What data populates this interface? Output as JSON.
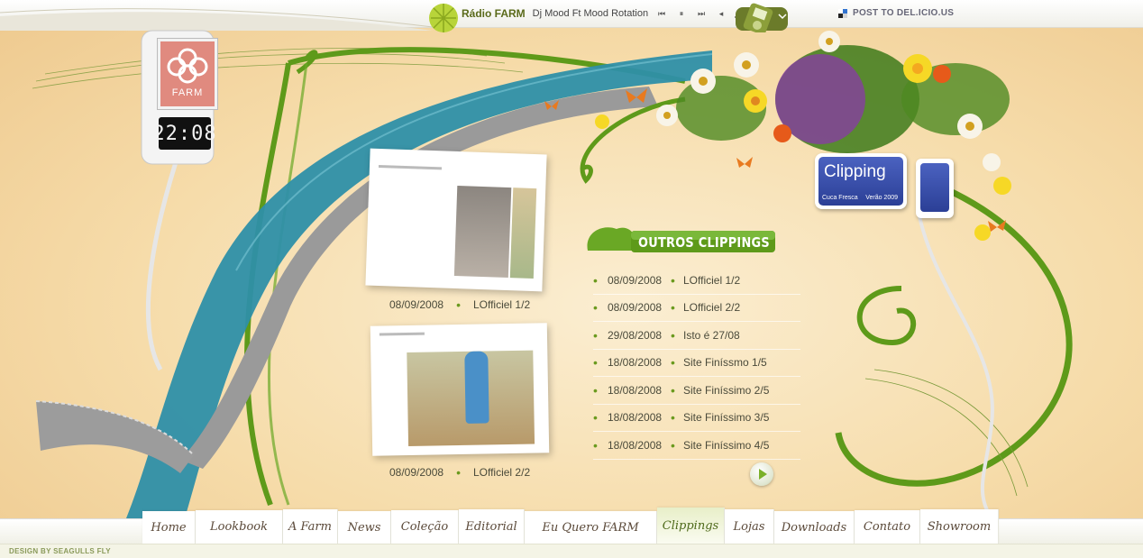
{
  "radio": {
    "label": "Rádio FARM",
    "song": "Dj Mood Ft Mood Rotation",
    "prev_icon": "skip-back-icon",
    "pause_icon": "pause-icon",
    "next_icon": "skip-forward-icon",
    "volume_icon": "volume-icon"
  },
  "post_to_delicious": "POST TO DEL.ICIO.US",
  "clock": {
    "time": "22:08",
    "brand": "FARM"
  },
  "sign": {
    "title": "Clipping",
    "left_sub": "Cuca Fresca",
    "right_sub": "Verão 2009"
  },
  "featured": [
    {
      "date": "08/09/2008",
      "title": "LOfficiel 1/2"
    },
    {
      "date": "08/09/2008",
      "title": "LOfficiel 2/2"
    }
  ],
  "outros": {
    "title": "OUTROS CLIPPINGS",
    "items": [
      {
        "date": "08/09/2008",
        "title": "LOfficiel 1/2"
      },
      {
        "date": "08/09/2008",
        "title": "LOfficiel 2/2"
      },
      {
        "date": "29/08/2008",
        "title": "Isto é  27/08"
      },
      {
        "date": "18/08/2008",
        "title": "Site Finíssmo 1/5"
      },
      {
        "date": "18/08/2008",
        "title": "Site Finíssimo 2/5"
      },
      {
        "date": "18/08/2008",
        "title": "Site Finíssimo 3/5"
      },
      {
        "date": "18/08/2008",
        "title": "Site Finíssimo 4/5"
      }
    ]
  },
  "nav": [
    {
      "label": "Home",
      "active": false
    },
    {
      "label": "Lookbook",
      "active": false
    },
    {
      "label": "A Farm",
      "active": false
    },
    {
      "label": "News",
      "active": false
    },
    {
      "label": "Coleção",
      "active": false
    },
    {
      "label": "Editorial",
      "active": false
    },
    {
      "label": "Eu Quero FARM",
      "active": false
    },
    {
      "label": "Clippings",
      "active": true
    },
    {
      "label": "Lojas",
      "active": false
    },
    {
      "label": "Downloads",
      "active": false
    },
    {
      "label": "Contato",
      "active": false
    },
    {
      "label": "Showroom",
      "active": false
    }
  ],
  "footer": "DESIGN BY SEAGULLS FLY",
  "colors": {
    "accent_green": "#6a9a1e",
    "ribbon_blue": "#2e8fa8",
    "sign_blue": "#3a51ad"
  }
}
